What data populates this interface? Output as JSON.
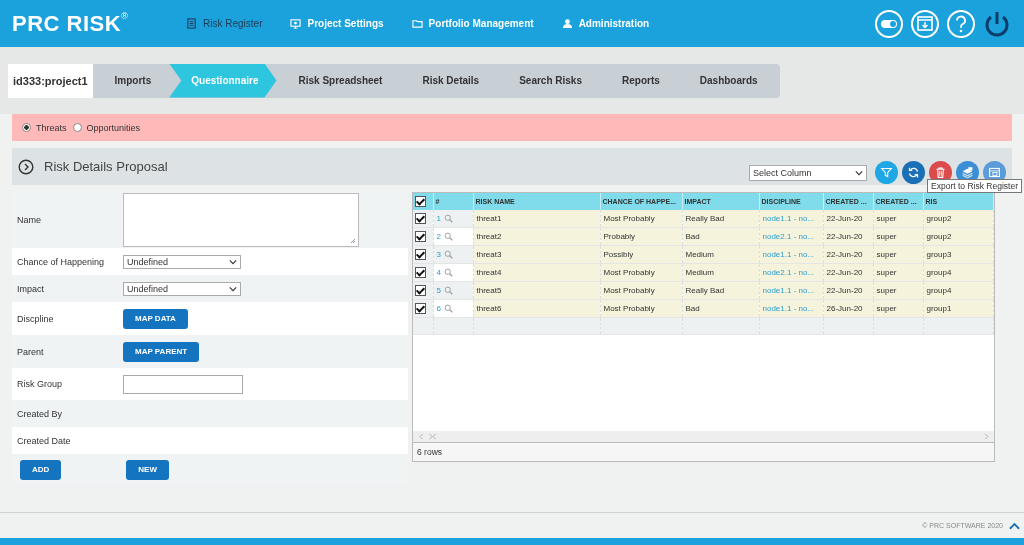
{
  "header": {
    "logo": "PRC RISK",
    "logo_mark": "®",
    "nav": [
      {
        "label": "Risk Register",
        "selected": true
      },
      {
        "label": "Project Settings",
        "selected": false
      },
      {
        "label": "Portfolio Management",
        "selected": false
      },
      {
        "label": "Administration",
        "selected": false
      }
    ]
  },
  "breadcrumb": {
    "project": "id333:project1",
    "steps": [
      {
        "label": "Imports",
        "selected": false
      },
      {
        "label": "Questionnaire",
        "selected": true
      },
      {
        "label": "Risk Spreadsheet",
        "selected": false
      },
      {
        "label": "Risk Details",
        "selected": false
      },
      {
        "label": "Search Risks",
        "selected": false
      },
      {
        "label": "Reports",
        "selected": false
      },
      {
        "label": "Dashboards",
        "selected": false
      }
    ]
  },
  "risk_type": [
    {
      "label": "Threats",
      "selected": true
    },
    {
      "label": "Opportunities",
      "selected": false
    }
  ],
  "panel": {
    "title": "Risk Details Proposal",
    "select_column": "Select Column",
    "actions": [
      {
        "color": "#1ea7e4"
      },
      {
        "color": "#1b6fb5"
      },
      {
        "color": "#dc4b4b"
      },
      {
        "color": "#3b8fd6"
      },
      {
        "color": "#5a9bd8"
      }
    ],
    "tooltip": "Export to Risk Register",
    "form": [
      {
        "kind": "textarea",
        "label": "Name"
      },
      {
        "kind": "select",
        "label": "Chance of Happening",
        "value": "Undefined"
      },
      {
        "kind": "select",
        "label": "Impact",
        "value": "Undefined"
      },
      {
        "kind": "button",
        "label": "Discpline",
        "button": "MAP DATA"
      },
      {
        "kind": "button",
        "label": "Parent",
        "button": "MAP PARENT"
      },
      {
        "kind": "input",
        "label": "Risk Group"
      },
      {
        "kind": "text",
        "label": "Created By"
      },
      {
        "kind": "text",
        "label": "Created Date"
      }
    ],
    "form_buttons": [
      "ADD",
      "NEW"
    ],
    "table": {
      "all_checked": true,
      "columns": [
        "#",
        "RISK NAME",
        "CHANCE OF HAPPE...",
        "IMPACT",
        "DISCIPLINE",
        "CREATED ...",
        "CREATED ...",
        "RIS"
      ],
      "rows": [
        {
          "checked": true,
          "number": "1",
          "name": "threat1",
          "chance": "Most Probably",
          "impact": "Really Bad",
          "discipline": "node1.1 - no...",
          "created_on": "22-Jun-20",
          "created_by": "super",
          "group": "group2"
        },
        {
          "checked": true,
          "number": "2",
          "name": "threat2",
          "chance": "Probably",
          "impact": "Bad",
          "discipline": "node2.1 - no...",
          "created_on": "22-Jun-20",
          "created_by": "super",
          "group": "group2"
        },
        {
          "checked": true,
          "number": "3",
          "name": "threat3",
          "chance": "Possibly",
          "impact": "Medium",
          "discipline": "node1.1 - no...",
          "created_on": "22-Jun-20",
          "created_by": "super",
          "group": "group3"
        },
        {
          "checked": true,
          "number": "4",
          "name": "threat4",
          "chance": "Most Probably",
          "impact": "Medium",
          "discipline": "node2.1 - no...",
          "created_on": "22-Jun-20",
          "created_by": "super",
          "group": "group4"
        },
        {
          "checked": true,
          "number": "5",
          "name": "threat5",
          "chance": "Most Probably",
          "impact": "Really Bad",
          "discipline": "node1.1 - no...",
          "created_on": "22-Jun-20",
          "created_by": "super",
          "group": "group4"
        },
        {
          "checked": true,
          "number": "6",
          "name": "threat6",
          "chance": "Most Probably",
          "impact": "Bad",
          "discipline": "node1.1 - no...",
          "created_on": "26-Jun-20",
          "created_by": "super",
          "group": "group1"
        }
      ],
      "row_count": "6 rows"
    }
  },
  "footer": {
    "copyright": "© PRC SOFTWARE 2020"
  }
}
